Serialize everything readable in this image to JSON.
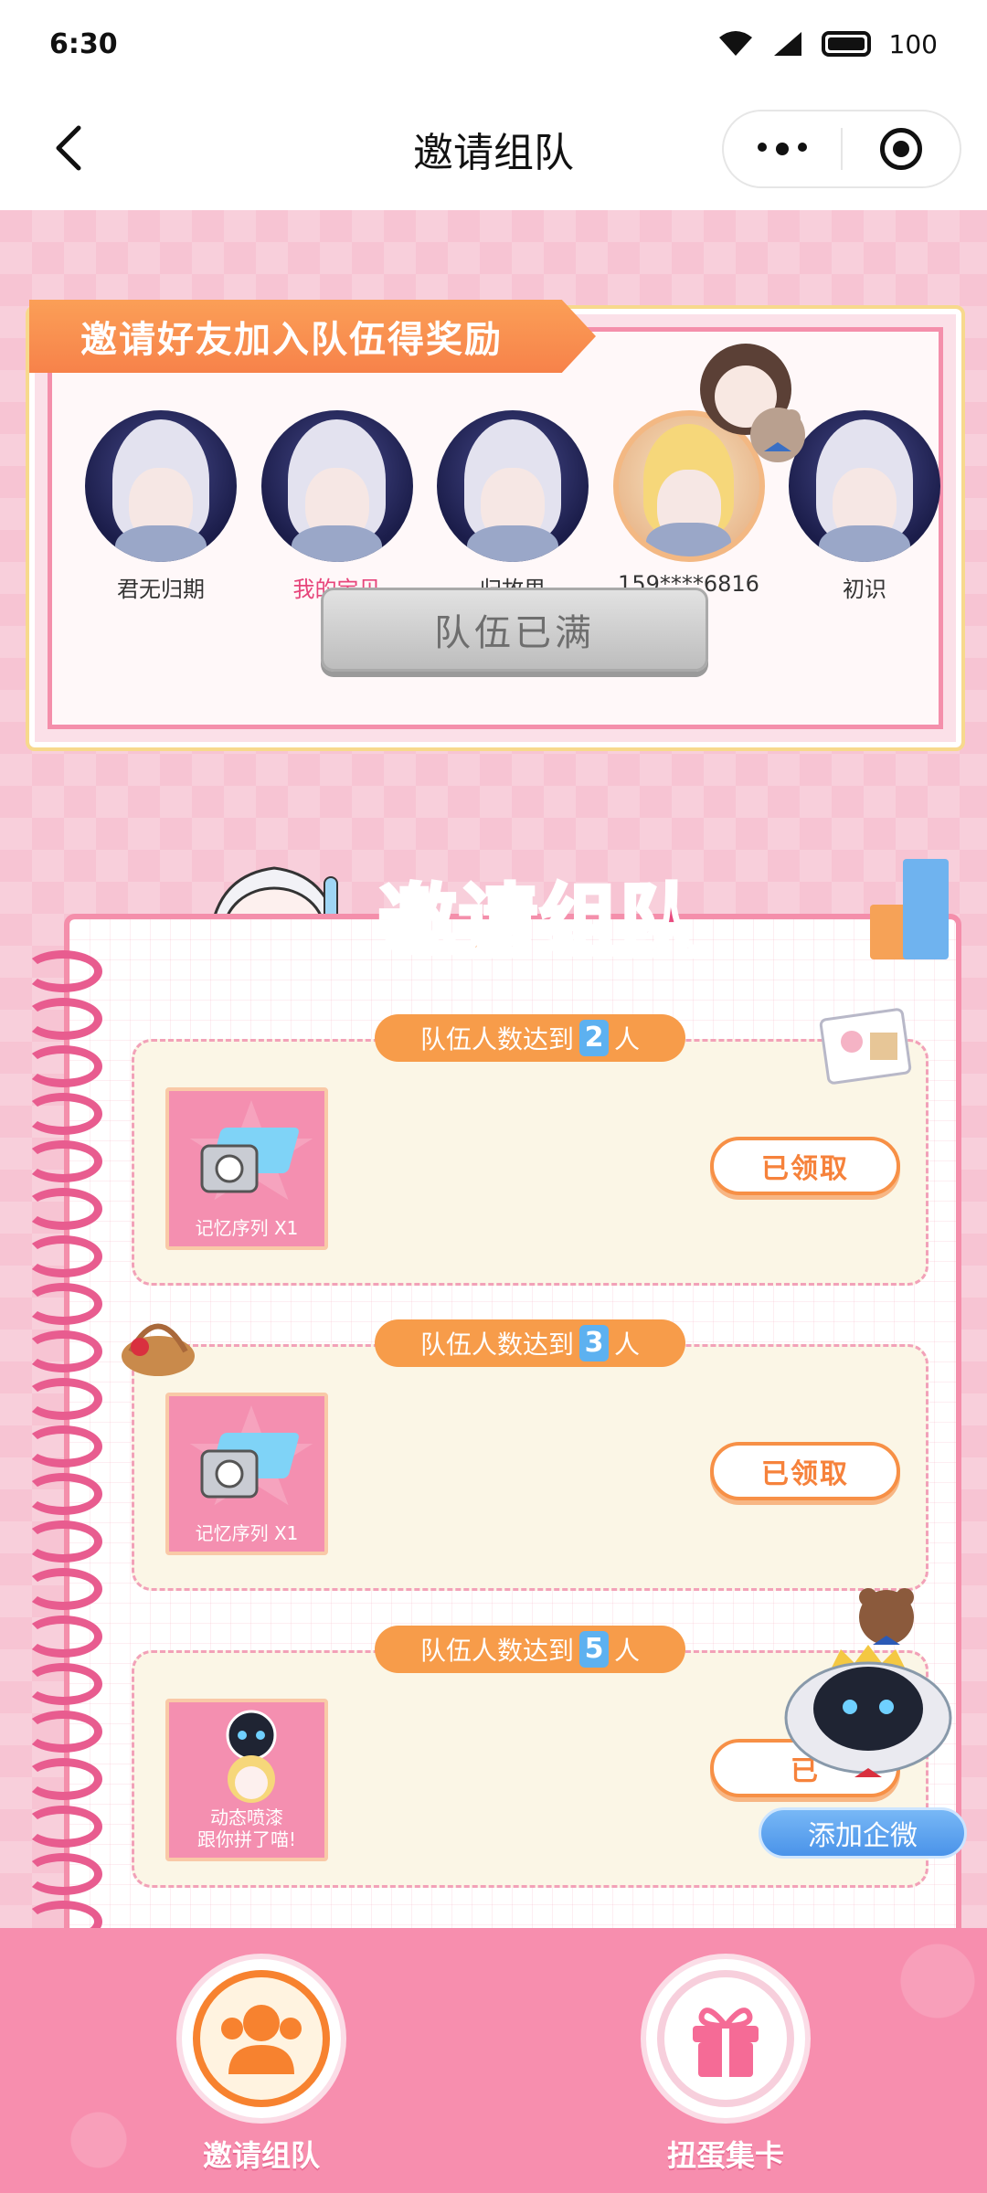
{
  "status_bar": {
    "time": "6:30",
    "battery": "100"
  },
  "navbar": {
    "title": "邀请组队"
  },
  "invite": {
    "banner": "邀请好友加入队伍得奖励",
    "members": [
      {
        "name": "君无归期",
        "highlight": false,
        "avatar": "silver-hair"
      },
      {
        "name": "我的宝贝",
        "highlight": true,
        "avatar": "silver-hair"
      },
      {
        "name": "归故里",
        "highlight": false,
        "avatar": "silver-hair"
      },
      {
        "name": "159****6816",
        "highlight": false,
        "avatar": "blonde-hair"
      },
      {
        "name": "初识",
        "highlight": false,
        "avatar": "silver-hair"
      }
    ],
    "status_button": "队伍已满"
  },
  "section": {
    "title_parts": [
      "邀请",
      "组",
      "队"
    ]
  },
  "tiers": [
    {
      "prefix": "队伍人数达到",
      "count": "2",
      "suffix": "人",
      "item_label": "记忆序列 X1",
      "button": "已领取"
    },
    {
      "prefix": "队伍人数达到",
      "count": "3",
      "suffix": "人",
      "item_label": "记忆序列 X1",
      "button": "已领取"
    },
    {
      "prefix": "队伍人数达到",
      "count": "5",
      "suffix": "人",
      "item_label_1": "动态喷漆",
      "item_label_2": "跟你拼了喵!",
      "button": "已"
    }
  ],
  "floating": {
    "add_wechat": "添加企微"
  },
  "tabbar": {
    "tabs": [
      {
        "label": "邀请组队"
      },
      {
        "label": "扭蛋集卡"
      }
    ]
  },
  "colors": {
    "primary_pink": "#f78eae",
    "accent_orange": "#f7822f",
    "accent_blue": "#5db1f0"
  }
}
